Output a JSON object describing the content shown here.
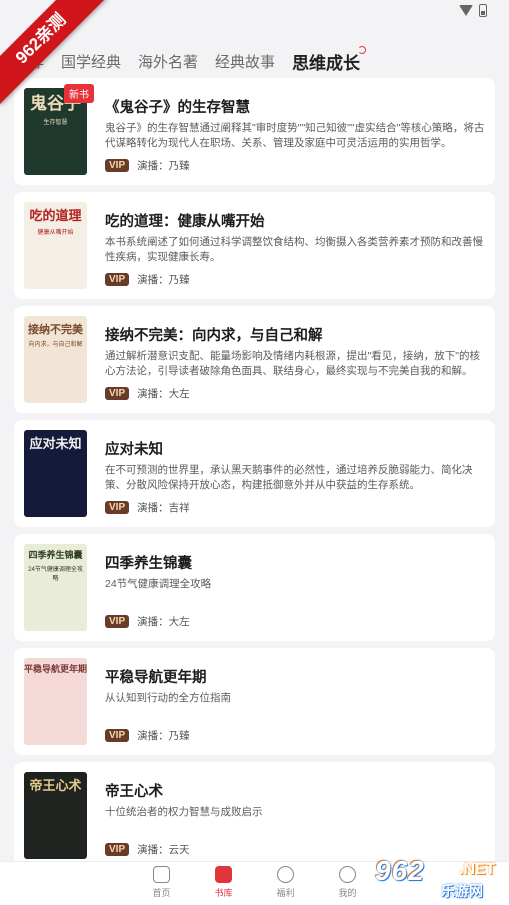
{
  "watermark": {
    "ribbon_text": "962亲测",
    "site_num": "962",
    "site_net": ".NET",
    "site_cn": "乐游网"
  },
  "tabs": [
    {
      "label": "推荐",
      "active": false
    },
    {
      "label": "国学经典",
      "active": false
    },
    {
      "label": "海外名著",
      "active": false
    },
    {
      "label": "经典故事",
      "active": false
    },
    {
      "label": "思维成长",
      "active": true
    }
  ],
  "vip_label": "VIP",
  "books": [
    {
      "title": "《鬼谷子》的生存智慧",
      "description": "鬼谷子》的生存智慧通过阐释其\"审时度势\"\"知己知彼\"\"虚实结合\"等核心策略，将古代谋略转化为现代人在职场、关系、管理及家庭中可灵活运用的实用哲学。",
      "narrator": "演播：乃臻",
      "badge": "新书",
      "cover_text": "鬼谷子",
      "cover_sub": "生存智慧",
      "cover_bg": "#1f3a2c",
      "cover_fg": "#e9dcb8"
    },
    {
      "title": "吃的道理：健康从嘴开始",
      "description": "本书系统阐述了如何通过科学调整饮食结构、均衡摄入各类营养素才预防和改善慢性疾病，实现健康长寿。",
      "narrator": "演播：乃臻",
      "badge": "",
      "cover_text": "吃的道理",
      "cover_sub": "健康从嘴开始",
      "cover_bg": "#f5eee4",
      "cover_fg": "#b32222"
    },
    {
      "title": "接纳不完美：向内求，与自己和解",
      "description": "通过解析潜意识支配、能量场影响及情绪内耗根源，提出\"看见，接纳，放下\"的核心方法论，引导读者破除角色面具、联结身心，最终实现与不完美自我的和解。",
      "narrator": "演播：大左",
      "badge": "",
      "cover_text": "接纳不完美",
      "cover_sub": "向内求，与自己和解",
      "cover_bg": "#f1e6d6",
      "cover_fg": "#7a4a2a"
    },
    {
      "title": "应对未知",
      "description": "在不可预测的世界里，承认黑天鹅事件的必然性，通过培养反脆弱能力、简化决策、分散风险保持开放心态，构建抵御意外并从中获益的生存系统。",
      "narrator": "演播：吉祥",
      "badge": "",
      "cover_text": "应对未知",
      "cover_sub": "",
      "cover_bg": "#131a3a",
      "cover_fg": "#f0f0f0"
    },
    {
      "title": "四季养生锦囊",
      "description": "24节气健康调理全攻略",
      "narrator": "演播：大左",
      "badge": "",
      "cover_text": "四季养生锦囊",
      "cover_sub": "24节气健康调理全攻略",
      "cover_bg": "#e9ecd6",
      "cover_fg": "#2c3d22"
    },
    {
      "title": "平稳导航更年期",
      "description": "从认知到行动的全方位指南",
      "narrator": "演播：乃臻",
      "badge": "",
      "cover_text": "平稳导航更年期",
      "cover_sub": "",
      "cover_bg": "#f5d9d6",
      "cover_fg": "#7a3a3a"
    },
    {
      "title": "帝王心术",
      "description": "十位统治者的权力智慧与成败启示",
      "narrator": "演播：云天",
      "badge": "",
      "cover_text": "帝王心术",
      "cover_sub": "",
      "cover_bg": "#1e231f",
      "cover_fg": "#e2c98a"
    }
  ],
  "bottom_nav": [
    {
      "label": "首页",
      "icon": "play-square-icon",
      "active": false
    },
    {
      "label": "书库",
      "icon": "bookmark-icon",
      "active": true
    },
    {
      "label": "福利",
      "icon": "gift-circle-icon",
      "active": false
    },
    {
      "label": "我的",
      "icon": "smile-face-icon",
      "active": false
    }
  ]
}
